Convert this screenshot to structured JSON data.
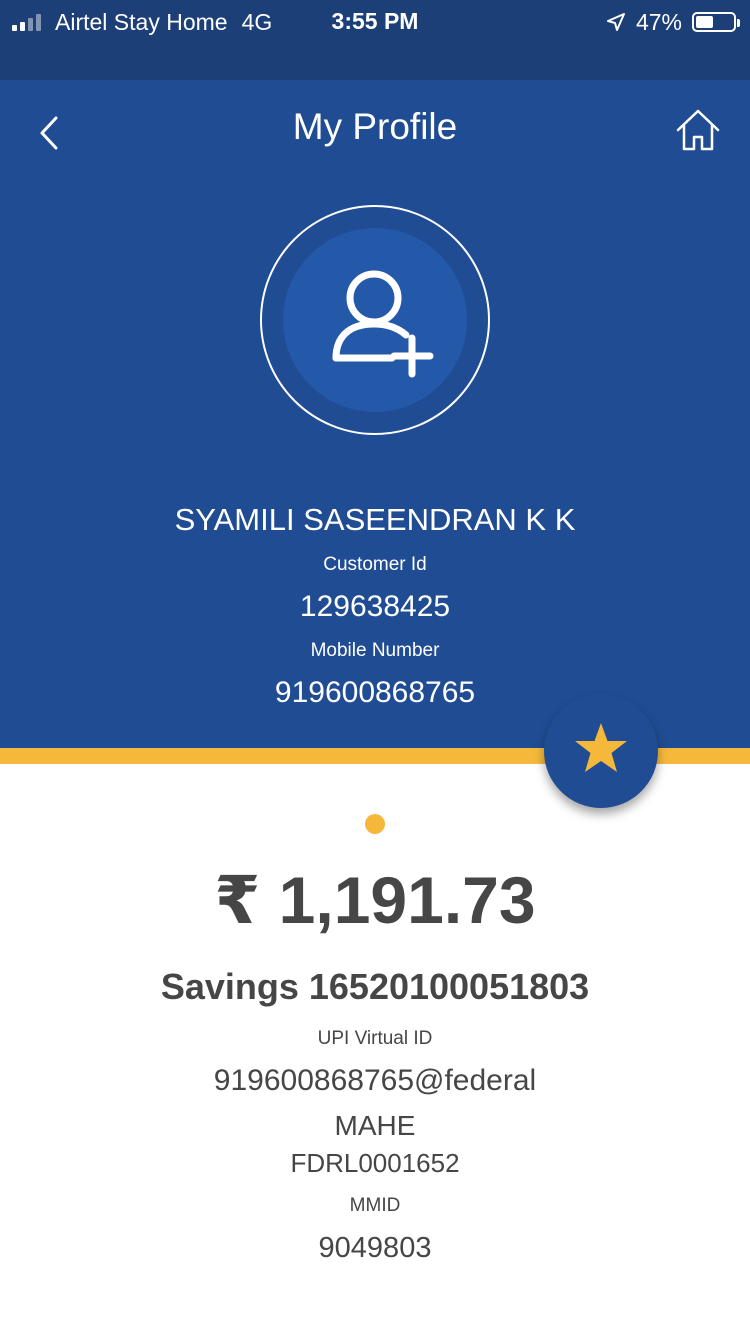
{
  "status_bar": {
    "carrier": "Airtel Stay Home",
    "network": "4G",
    "time": "3:55 PM",
    "battery_text": "47%",
    "battery_level": 0.47
  },
  "header": {
    "title": "My Profile",
    "back_icon": "chevron-left-icon",
    "home_icon": "home-icon"
  },
  "profile": {
    "avatar_icon": "add-user-icon",
    "name": "SYAMILI SASEENDRAN K K",
    "customer_id_label": "Customer Id",
    "customer_id": "129638425",
    "mobile_label": "Mobile Number",
    "mobile": "919600868765"
  },
  "favorite": {
    "icon": "star-icon"
  },
  "account": {
    "balance": "₹ 1,191.73",
    "account_line": "Savings 16520100051803",
    "upi_label": "UPI Virtual ID",
    "upi_id": "919600868765@federal",
    "branch": "MAHE",
    "ifsc": "FDRL0001652",
    "mmid_label": "MMID",
    "mmid": "9049803"
  },
  "colors": {
    "header_blue": "#1f4c93",
    "status_blue": "#1b3f76",
    "accent_yellow": "#f4b93b",
    "text_dark": "#464646"
  }
}
